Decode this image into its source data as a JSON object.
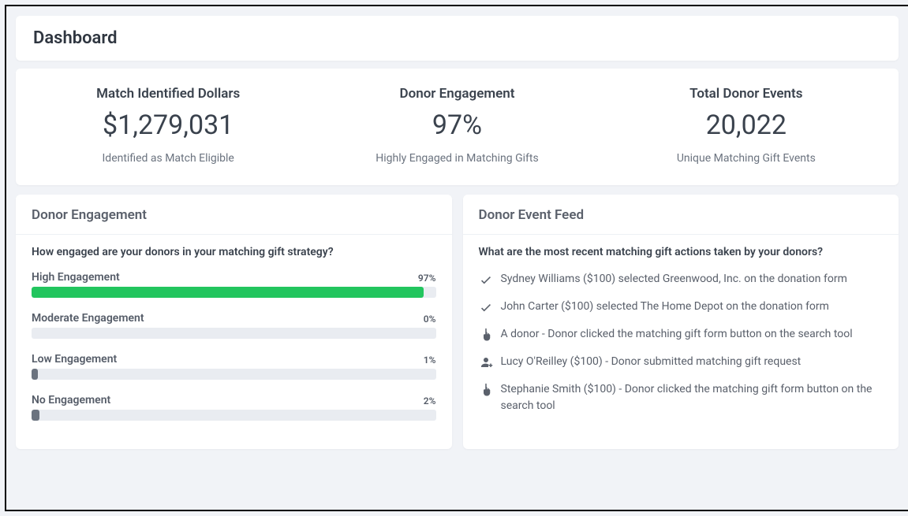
{
  "page_title": "Dashboard",
  "metrics": [
    {
      "title": "Match Identified Dollars",
      "value": "$1,279,031",
      "sub": "Identified as Match Eligible"
    },
    {
      "title": "Donor Engagement",
      "value": "97%",
      "sub": "Highly Engaged in Matching Gifts"
    },
    {
      "title": "Total Donor Events",
      "value": "20,022",
      "sub": "Unique Matching Gift Events"
    }
  ],
  "engagement": {
    "title": "Donor Engagement",
    "question": "How engaged are your donors in your matching gift strategy?",
    "chart_data": {
      "type": "bar",
      "categories": [
        "High Engagement",
        "Moderate Engagement",
        "Low Engagement",
        "No Engagement"
      ],
      "values": [
        97,
        0,
        1,
        2
      ],
      "ylim": [
        0,
        100
      ],
      "unit": "%",
      "colors": [
        "#22c55e",
        "#6b737f",
        "#6b737f",
        "#6b737f"
      ]
    }
  },
  "feed": {
    "title": "Donor Event Feed",
    "question": "What are the most recent matching gift actions taken by your donors?",
    "items": [
      {
        "icon": "check",
        "text": "Sydney Williams ($100) selected Greenwood, Inc. on the donation form"
      },
      {
        "icon": "check",
        "text": "John Carter ($100) selected The Home Depot on the donation form"
      },
      {
        "icon": "pointer",
        "text": "A donor - Donor clicked the matching gift form button on the search tool"
      },
      {
        "icon": "user",
        "text": "Lucy O'Reilley ($100) - Donor submitted matching gift request"
      },
      {
        "icon": "pointer",
        "text": "Stephanie Smith ($100) - Donor clicked the matching gift form button on the search tool"
      }
    ]
  }
}
